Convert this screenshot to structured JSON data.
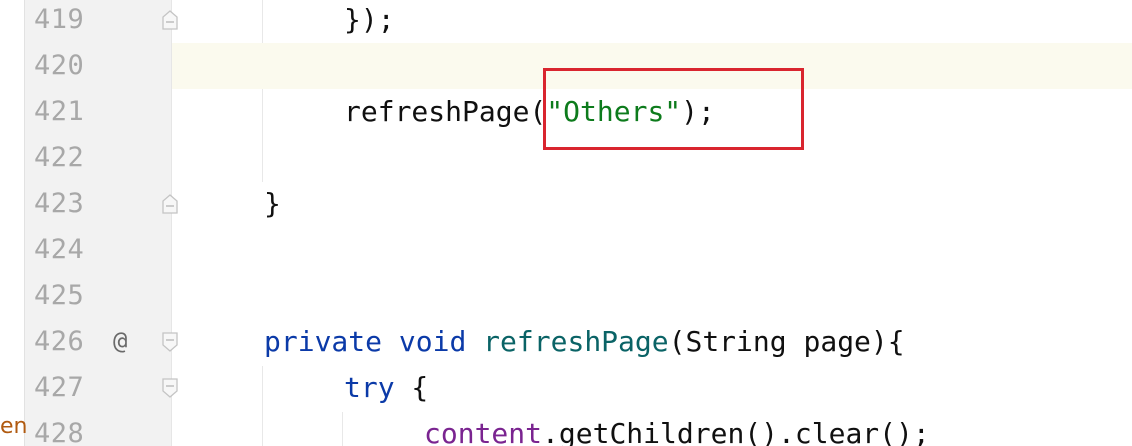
{
  "editor": {
    "left_strip_label": "en",
    "lines": [
      {
        "number": "419",
        "code": "});"
      },
      {
        "number": "420",
        "code": ""
      },
      {
        "number": "421",
        "code_before": "refreshPage(",
        "string": "\"Others\"",
        "code_after": ");"
      },
      {
        "number": "422",
        "code": ""
      },
      {
        "number": "423",
        "code": "}"
      },
      {
        "number": "424",
        "code": ""
      },
      {
        "number": "425",
        "code": ""
      },
      {
        "number": "426",
        "marker": "@",
        "kw1": "private",
        "kw2": "void",
        "fn": "refreshPage",
        "paren_open": "(",
        "type": "String",
        "param": " page){"
      },
      {
        "number": "427",
        "kw": "try",
        "rest": " {"
      },
      {
        "number": "428",
        "field": "content",
        "rest": ".getChildren().clear();"
      }
    ]
  },
  "colors": {
    "keyword": "#0b3aa8",
    "string": "#0d7b1c",
    "field": "#7a2490",
    "current_line": "#fbfaee",
    "highlight_box": "#d9252f"
  },
  "icons": {
    "fold_end": "fold-end-icon",
    "fold_start": "fold-start-icon",
    "override": "at-marker"
  }
}
